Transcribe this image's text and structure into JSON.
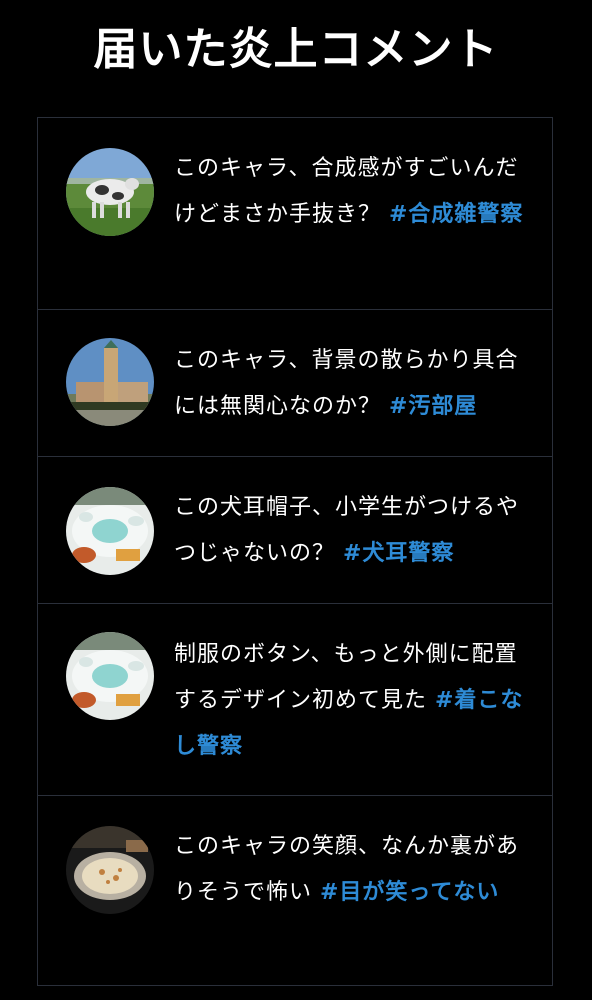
{
  "header": {
    "title": "届いた炎上コメント"
  },
  "colors": {
    "background": "#000000",
    "text": "#ffffff",
    "hashtag": "#2e8bd6",
    "divider": "#2a2f3a"
  },
  "comments": [
    {
      "avatar": "cow-photo",
      "text": "このキャラ、合成感がすごいんだけどまさか手抜き？ ",
      "hashtag": "#合成雑警察"
    },
    {
      "avatar": "clock-tower-photo",
      "text": "このキャラ、背景の散らかり具合には無関心なのか？ ",
      "hashtag": "#汚部屋"
    },
    {
      "avatar": "dining-table-photo",
      "text": "この犬耳帽子、小学生がつけるやつじゃないの？ ",
      "hashtag": "#犬耳警察"
    },
    {
      "avatar": "dining-table-photo",
      "text": "制服のボタン、もっと外側に配置するデザイン初めて見た ",
      "hashtag": "#着こなし警察"
    },
    {
      "avatar": "pizza-photo",
      "text": "このキャラの笑顔、なんか裏がありそうで怖い ",
      "hashtag": "#目が笑ってない"
    }
  ]
}
